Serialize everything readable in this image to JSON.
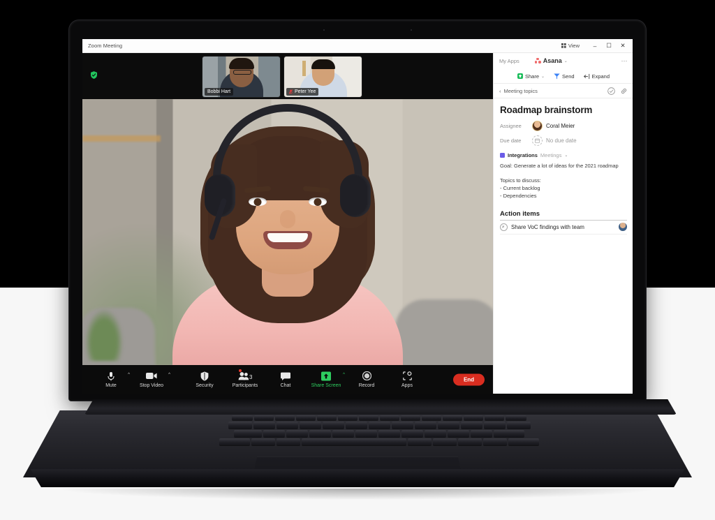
{
  "window": {
    "title": "Zoom Meeting",
    "view_label": "View",
    "minimize_label": "–",
    "maximize_label": "☐",
    "close_label": "✕"
  },
  "meeting": {
    "encryption_badge": "shield-check",
    "thumbnails": [
      {
        "name": "Bobbi Hart",
        "muted": false
      },
      {
        "name": "Peter Yee",
        "muted": true
      }
    ],
    "toolbar": [
      {
        "label": "Mute",
        "icon": "microphone-icon",
        "caret": true,
        "accent": false
      },
      {
        "label": "Stop Video",
        "icon": "camera-icon",
        "caret": true,
        "accent": false
      },
      {
        "label": "Security",
        "icon": "shield-icon",
        "caret": false,
        "accent": false
      },
      {
        "label": "Participants",
        "icon": "people-icon",
        "caret": false,
        "accent": false,
        "count": "3",
        "badge": true
      },
      {
        "label": "Chat",
        "icon": "chat-bubble-icon",
        "caret": false,
        "accent": false
      },
      {
        "label": "Share Screen",
        "icon": "share-screen-icon",
        "caret": true,
        "accent": true
      },
      {
        "label": "Record",
        "icon": "record-icon",
        "caret": false,
        "accent": false
      },
      {
        "label": "Apps",
        "icon": "apps-icon",
        "caret": false,
        "accent": false
      }
    ],
    "end_label": "End"
  },
  "asana": {
    "my_apps_label": "My Apps",
    "app_name": "Asana",
    "app_chevron": "⌄",
    "overflow": "⋯",
    "actions": [
      {
        "label": "Share",
        "icon": "share-icon",
        "chevron": true
      },
      {
        "label": "Send",
        "icon": "send-icon",
        "chevron": false
      },
      {
        "label": "Expand",
        "icon": "expand-icon",
        "chevron": false
      }
    ],
    "breadcrumb": "Meeting topics",
    "back_chevron": "‹",
    "task": {
      "title": "Roadmap brainstorm",
      "assignee_label": "Assignee",
      "assignee_name": "Coral Meier",
      "due_date_label": "Due date",
      "due_date_value": "No due date",
      "project_name": "Integrations",
      "project_section": "Meetings",
      "project_chevron": "⌄",
      "project_color": "#6b5ce7",
      "description_goal": "Goal: Generate a lot of ideas for the 2021 roadmap",
      "description_topics": "Topics to discuss:\n- Current backlog\n- Dependencies"
    },
    "action_items_title": "Action items",
    "action_items": [
      {
        "text": "Share VoC findings with team"
      }
    ]
  },
  "colors": {
    "accent_green": "#2ecc5f",
    "end_red": "#d92d20",
    "asana_coral": "#f06a6a",
    "send_blue": "#3b82f6",
    "project_purple": "#6b5ce7"
  }
}
